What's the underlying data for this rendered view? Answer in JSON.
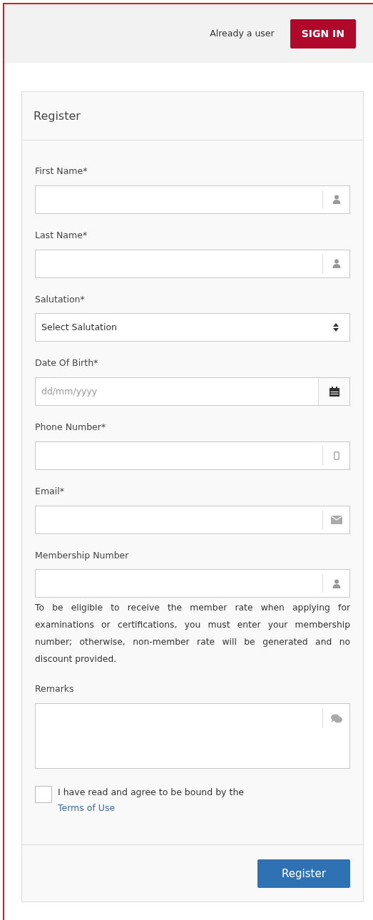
{
  "header": {
    "prompt": "Already a user",
    "sign_in": "SIGN IN"
  },
  "card": {
    "title": "Register",
    "fields": [
      {
        "kind": "name",
        "label": "First Name*"
      },
      {
        "kind": "name",
        "label": "Last Name*"
      },
      {
        "kind": "select",
        "label": "Salutation*",
        "value": "Select Salutation"
      },
      {
        "kind": "date",
        "label": "Date Of Birth*",
        "placeholder": "dd/mm/yyyy"
      },
      {
        "kind": "phone",
        "label": "Phone Number*"
      },
      {
        "kind": "email",
        "label": "Email*"
      },
      {
        "kind": "name",
        "label": "Membership Number",
        "help": "To be eligible to receive the member rate when applying for examinations or certifications, you must enter your membership number; otherwise, non-member rate will be generated and no discount provided."
      },
      {
        "kind": "textarea",
        "label": "Remarks"
      }
    ],
    "agreement": {
      "text": "I have read and agree to be bound by the",
      "link": "Terms of Use",
      "checked": false
    },
    "submit": "Register"
  }
}
